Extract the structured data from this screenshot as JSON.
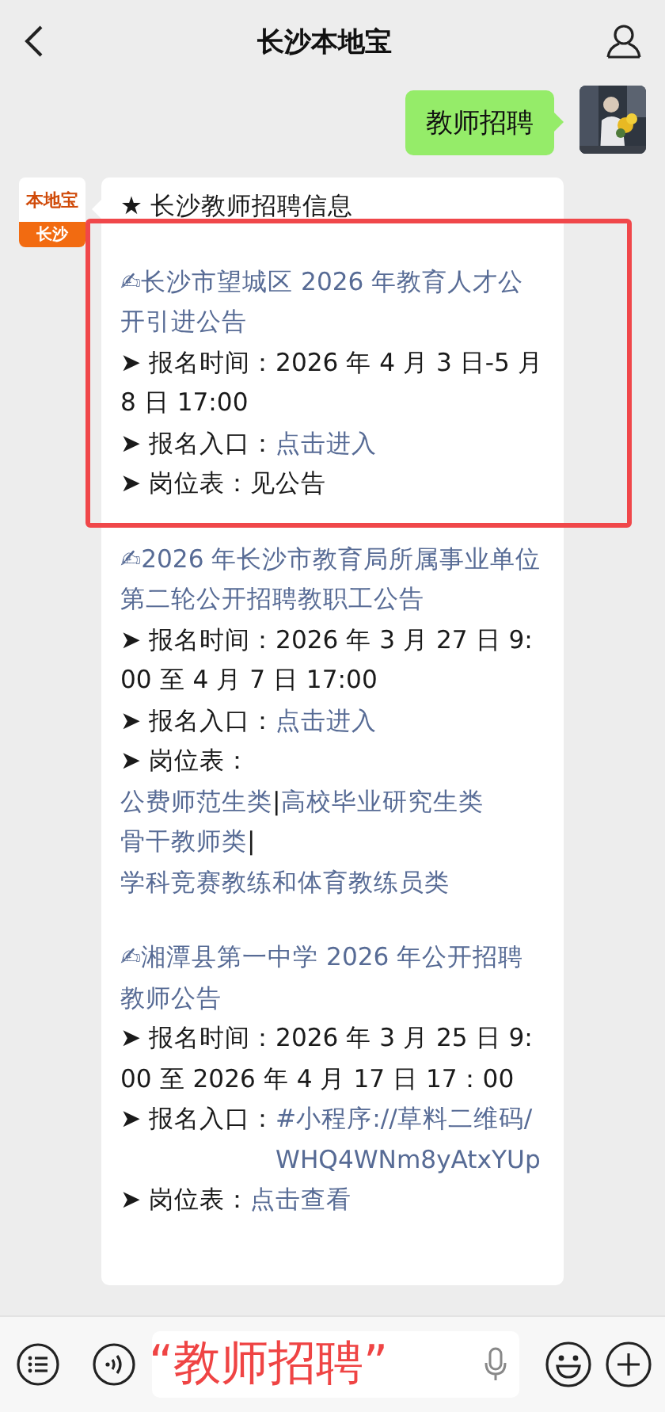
{
  "header": {
    "title": "长沙本地宝"
  },
  "sent_message": {
    "text": "教师招聘"
  },
  "received_message": {
    "logo": {
      "brand": "本地宝",
      "city": "长沙"
    },
    "heading": "★ 长沙教师招聘信息",
    "items": [
      {
        "highlighted": true,
        "title": "✍长沙市望城区 2026 年教育人才公开引进公告",
        "lines": [
          {
            "label": "➤ 报名时间：",
            "parts": [
              {
                "kind": "text",
                "text": "2026 年 4 月 3 日-5 月 8 日 17:00"
              }
            ]
          },
          {
            "label": "➤ 报名入口：",
            "parts": [
              {
                "kind": "link",
                "text": "点击进入"
              }
            ]
          },
          {
            "label": "➤ 岗位表：",
            "parts": [
              {
                "kind": "text",
                "text": "见公告"
              }
            ]
          }
        ]
      },
      {
        "highlighted": false,
        "title": "✍2026 年长沙市教育局所属事业单位第二轮公开招聘教职工公告",
        "lines": [
          {
            "label": "➤ 报名时间：",
            "parts": [
              {
                "kind": "text",
                "text": "2026 年 3 月 27 日 9:00 至 4 月 7 日 17:00"
              }
            ]
          },
          {
            "label": "➤ 报名入口：",
            "parts": [
              {
                "kind": "link",
                "text": "点击进入"
              }
            ]
          },
          {
            "label": "➤ 岗位表：",
            "parts": [
              {
                "kind": "break"
              },
              {
                "kind": "link",
                "text": "公费师范生类"
              },
              {
                "kind": "separator",
                "text": "|"
              },
              {
                "kind": "link",
                "text": "高校毕业研究生类"
              },
              {
                "kind": "link",
                "text": "骨干教师类"
              },
              {
                "kind": "separator",
                "text": "|"
              },
              {
                "kind": "link",
                "text": "学科竞赛教练和体育教练员类"
              }
            ]
          }
        ]
      },
      {
        "highlighted": false,
        "title": "✍湘潭县第一中学 2026 年公开招聘教师公告",
        "lines": [
          {
            "label": "➤ 报名时间：",
            "parts": [
              {
                "kind": "text",
                "text": "2026 年 3 月 25 日 9:00 至 2026 年 4 月 17 日 17：00"
              }
            ]
          },
          {
            "label": "➤ 报名入口：",
            "parts": [
              {
                "kind": "link",
                "text": "#小程序://草料二维码/WHQ4WNm8yAtxYUp"
              }
            ]
          },
          {
            "label": "➤ 岗位表：",
            "parts": [
              {
                "kind": "link",
                "text": "点击查看"
              }
            ]
          }
        ]
      }
    ]
  },
  "input_bar": {
    "overlay_caption": "“教师招聘”"
  }
}
